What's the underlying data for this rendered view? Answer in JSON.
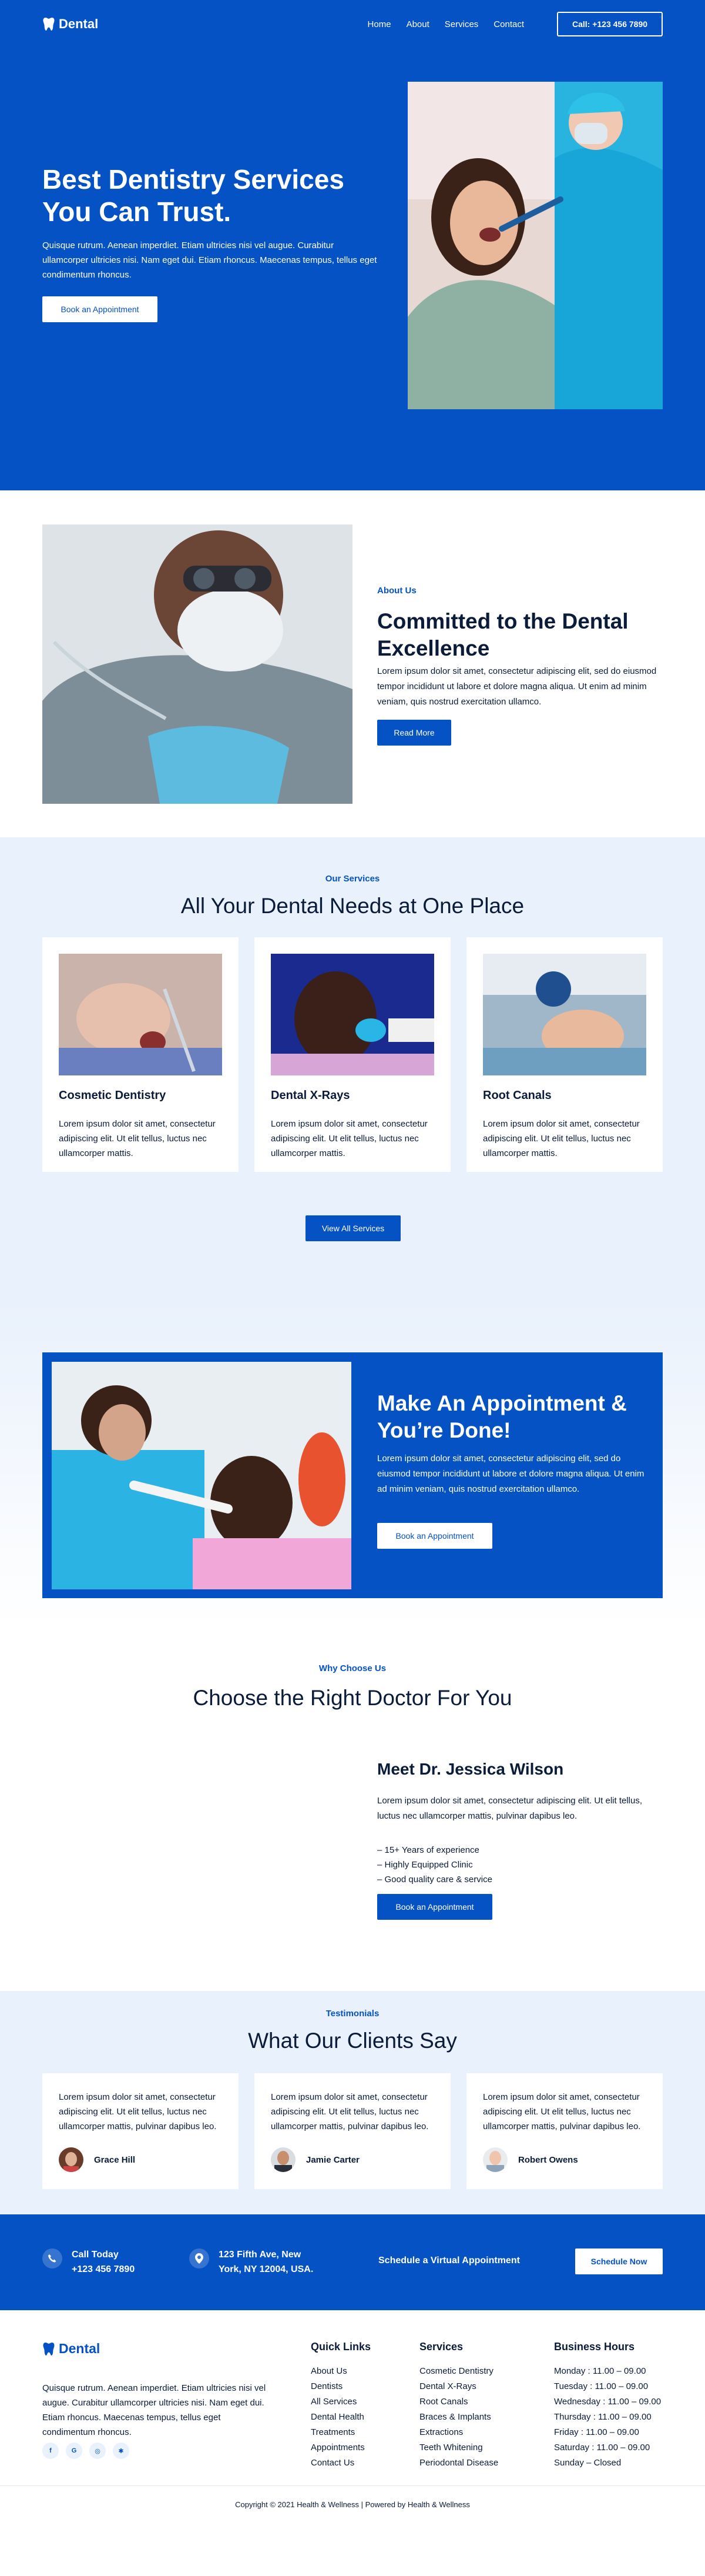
{
  "brand": {
    "name": "Dental",
    "accent": "#0452c4",
    "light_bg": "#e9f1fc"
  },
  "nav": {
    "links": [
      "Home",
      "About",
      "Services",
      "Contact"
    ],
    "call": "Call: +123 456 7890"
  },
  "hero": {
    "title": "Best Dentistry Services You Can Trust.",
    "text": "Quisque rutrum. Aenean imperdiet. Etiam ultricies nisi vel augue. Curabitur ullamcorper ultricies nisi. Nam eget dui. Etiam rhoncus. Maecenas tempus, tellus eget condimentum rhoncus.",
    "button": "Book an Appointment"
  },
  "about": {
    "eyebrow": "About Us",
    "title": "Committed to the Dental Excellence",
    "text": "Lorem ipsum dolor sit amet, consectetur adipiscing elit, sed do eiusmod tempor incididunt ut labore et dolore magna aliqua. Ut enim ad minim veniam, quis nostrud exercitation ullamco.",
    "button": "Read More"
  },
  "services": {
    "eyebrow": "Our Services",
    "title": "All Your Dental Needs at One Place",
    "cards": [
      {
        "title": "Cosmetic Dentistry",
        "text": "Lorem ipsum dolor sit amet, consectetur adipiscing elit. Ut elit tellus, luctus nec ullamcorper mattis."
      },
      {
        "title": "Dental X-Rays",
        "text": "Lorem ipsum dolor sit amet, consectetur adipiscing elit. Ut elit tellus, luctus nec ullamcorper mattis."
      },
      {
        "title": "Root Canals",
        "text": "Lorem ipsum dolor sit amet, consectetur adipiscing elit. Ut elit tellus, luctus nec ullamcorper mattis."
      }
    ],
    "button": "View All Services"
  },
  "appointment": {
    "title": "Make An Appointment & You’re Done!",
    "text": "Lorem ipsum dolor sit amet, consectetur adipiscing elit, sed do eiusmod tempor incididunt ut labore et dolore magna aliqua. Ut enim ad minim veniam, quis nostrud exercitation ullamco.",
    "button": "Book an Appointment"
  },
  "doctor": {
    "eyebrow": "Why Choose Us",
    "title": "Choose the Right Doctor For You",
    "name": "Meet Dr. Jessica Wilson",
    "text": "Lorem ipsum dolor sit amet, consectetur adipiscing elit. Ut elit tellus, luctus nec ullamcorper mattis, pulvinar dapibus leo.",
    "points": [
      "– 15+ Years of experience",
      "– Highly Equipped Clinic",
      "– Good quality care & service"
    ],
    "button": "Book an Appointment"
  },
  "testimonials": {
    "eyebrow": "Testimonials",
    "title": "What Our Clients Say",
    "items": [
      {
        "text": "Lorem ipsum dolor sit amet, consectetur adipiscing elit. Ut elit tellus, luctus nec ullamcorper mattis, pulvinar dapibus leo.",
        "name": "Grace Hill"
      },
      {
        "text": "Lorem ipsum dolor sit amet, consectetur adipiscing elit. Ut elit tellus, luctus nec ullamcorper mattis, pulvinar dapibus leo.",
        "name": "Jamie Carter"
      },
      {
        "text": "Lorem ipsum dolor sit amet, consectetur adipiscing elit. Ut elit tellus, luctus nec ullamcorper mattis, pulvinar dapibus leo.",
        "name": "Robert Owens"
      }
    ]
  },
  "contact_strip": {
    "call_label": "Call Today",
    "phone": "+123 456 7890",
    "address_line1": "123 Fifth Ave, New",
    "address_line2": "York, NY 12004, USA.",
    "virtual": "Schedule a Virtual Appointment",
    "button": "Schedule Now"
  },
  "footer": {
    "text": "Quisque rutrum. Aenean imperdiet. Etiam ultricies nisi vel augue. Curabitur ullamcorper ultricies nisi. Nam eget dui. Etiam rhoncus. Maecenas tempus, tellus eget condimentum rhoncus.",
    "social": [
      "facebook-icon",
      "google-icon",
      "instagram-icon",
      "yelp-icon"
    ],
    "quick_links": {
      "title": "Quick Links",
      "items": [
        "About Us",
        "Dentists",
        "All Services",
        "Dental Health",
        "Treatments",
        "Appointments",
        "Contact Us"
      ]
    },
    "services": {
      "title": "Services",
      "items": [
        "Cosmetic Dentistry",
        "Dental X-Rays",
        "Root Canals",
        "Braces & Implants",
        "Extractions",
        "Teeth Whitening",
        "Periodontal Disease"
      ]
    },
    "hours": {
      "title": "Business Hours",
      "items": [
        "Monday : 11.00 – 09.00",
        "Tuesday : 11.00 – 09.00",
        "Wednesday : 11.00 – 09.00",
        "Thursday : 11.00 – 09.00",
        "Friday : 11.00 – 09.00",
        "Saturday : 11.00 – 09.00",
        "Sunday – Closed"
      ]
    },
    "copyright": "Copyright © 2021 Health & Wellness | Powered by Health & Wellness"
  }
}
